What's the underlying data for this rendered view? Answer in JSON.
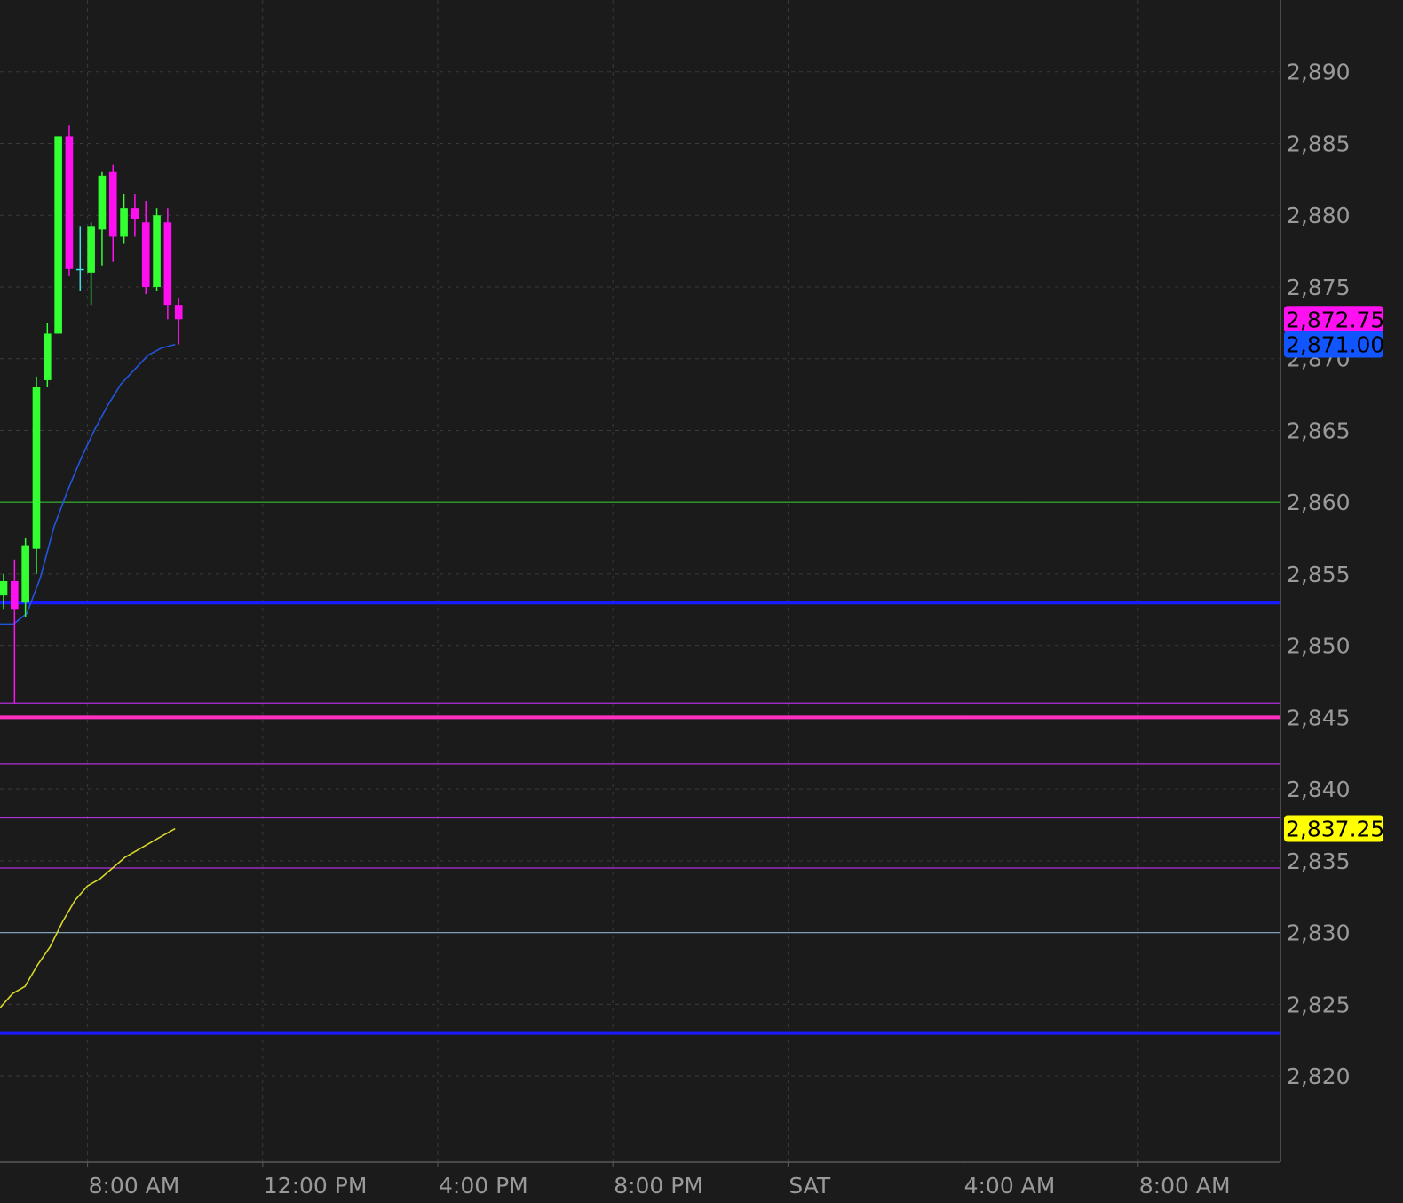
{
  "chart_data": {
    "type": "candlestick",
    "y_axis": {
      "side": "right",
      "ticks": [
        2890,
        2885,
        2880,
        2875,
        2870,
        2865,
        2860,
        2855,
        2850,
        2845,
        2840,
        2835,
        2830,
        2825,
        2820
      ],
      "tick_labels": [
        "2,890",
        "2,885",
        "2,880",
        "2,875",
        "2,870",
        "2,865",
        "2,860",
        "2,855",
        "2,850",
        "2,845",
        "2,840",
        "2,835",
        "2,830",
        "2,825",
        "2,820"
      ],
      "range": [
        2814.0,
        2895.0
      ]
    },
    "x_axis": {
      "range": [
        "Fri 06:00",
        "Sat 11:15"
      ],
      "ticks": [
        {
          "time": "Fri 08:00",
          "label": "8:00 AM"
        },
        {
          "time": "Fri 12:00",
          "label": "12:00 PM"
        },
        {
          "time": "Fri 16:00",
          "label": "4:00 PM"
        },
        {
          "time": "Fri 20:00",
          "label": "8:00 PM"
        },
        {
          "time": "Sat 00:00",
          "label": "SAT"
        },
        {
          "time": "Sat 04:00",
          "label": "4:00 AM"
        },
        {
          "time": "Sat 08:00",
          "label": "8:00 AM"
        }
      ]
    },
    "grid": true,
    "candles": [
      {
        "time": "Fri 06:00",
        "open": 2853.5,
        "high": 2855.0,
        "low": 2852.5,
        "close": 2854.5
      },
      {
        "time": "Fri 06:15",
        "open": 2854.5,
        "high": 2856.0,
        "low": 2846.0,
        "close": 2852.5
      },
      {
        "time": "Fri 06:30",
        "open": 2853.0,
        "high": 2857.5,
        "low": 2852.0,
        "close": 2857.0
      },
      {
        "time": "Fri 06:45",
        "open": 2856.75,
        "high": 2868.75,
        "low": 2855.0,
        "close": 2868.0
      },
      {
        "time": "Fri 07:00",
        "open": 2868.5,
        "high": 2872.5,
        "low": 2868.0,
        "close": 2871.75
      },
      {
        "time": "Fri 07:15",
        "open": 2871.75,
        "high": 2885.5,
        "low": 2871.75,
        "close": 2885.5
      },
      {
        "time": "Fri 07:30",
        "open": 2885.5,
        "high": 2886.25,
        "low": 2875.75,
        "close": 2876.25
      },
      {
        "time": "Fri 07:45",
        "open": 2876.25,
        "high": 2879.25,
        "low": 2874.75,
        "close": 2876.25
      },
      {
        "time": "Fri 08:00",
        "open": 2876.0,
        "high": 2879.5,
        "low": 2873.75,
        "close": 2879.25
      },
      {
        "time": "Fri 08:15",
        "open": 2879.0,
        "high": 2883.0,
        "low": 2876.5,
        "close": 2882.75
      },
      {
        "time": "Fri 08:30",
        "open": 2883.0,
        "high": 2883.5,
        "low": 2876.75,
        "close": 2878.5
      },
      {
        "time": "Fri 08:45",
        "open": 2878.5,
        "high": 2881.5,
        "low": 2878.0,
        "close": 2880.5
      },
      {
        "time": "Fri 09:00",
        "open": 2880.5,
        "high": 2881.5,
        "low": 2878.5,
        "close": 2879.75
      },
      {
        "time": "Fri 09:15",
        "open": 2879.5,
        "high": 2881.0,
        "low": 2874.5,
        "close": 2875.0
      },
      {
        "time": "Fri 09:30",
        "open": 2875.0,
        "high": 2880.5,
        "low": 2874.75,
        "close": 2880.0
      },
      {
        "time": "Fri 09:45",
        "open": 2879.5,
        "high": 2880.5,
        "low": 2872.75,
        "close": 2873.75
      },
      {
        "time": "Fri 10:00",
        "open": 2873.75,
        "high": 2874.25,
        "low": 2871.0,
        "close": 2872.75
      }
    ],
    "overlays": [
      {
        "type": "line",
        "color": "#2255dd",
        "values": [
          2851.5,
          2851.5,
          2852.25,
          2854.75,
          2858.25,
          2860.75,
          2863.0,
          2865.0,
          2866.75,
          2868.25,
          2869.25,
          2870.25,
          2870.75,
          2871.0
        ]
      },
      {
        "type": "line",
        "color": "#d6d628",
        "values": [
          2824.75,
          2825.75,
          2826.25,
          2827.75,
          2829.0,
          2830.75,
          2832.25,
          2833.25,
          2833.75,
          2834.5,
          2835.25,
          2835.75,
          2836.25,
          2836.75,
          2837.25
        ]
      }
    ],
    "levels": [
      {
        "value": 2860.0,
        "color": "#2ea12e"
      },
      {
        "value": 2853.0,
        "color": "#1a1aff"
      },
      {
        "value": 2846.0,
        "color": "#b030d8"
      },
      {
        "value": 2845.0,
        "color": "#ff30c0"
      },
      {
        "value": 2841.75,
        "color": "#b030d8"
      },
      {
        "value": 2838.0,
        "color": "#b030d8"
      },
      {
        "value": 2834.5,
        "color": "#b030d8"
      },
      {
        "value": 2830.0,
        "color": "#7fa0b8"
      },
      {
        "value": 2823.0,
        "color": "#1a1aff"
      }
    ],
    "price_labels": [
      {
        "value": 2872.75,
        "label": "2,872.75",
        "bg": "#ff10f0"
      },
      {
        "value": 2871.0,
        "label": "2,871.00",
        "bg": "#1155ff"
      },
      {
        "value": 2837.25,
        "label": "2,837.25",
        "bg": "#ffff00"
      }
    ],
    "colors": {
      "background": "#1b1b1c",
      "up": "#33ff33",
      "down": "#ff10f0",
      "doji": "#44dddd",
      "grid": "#3a3a3a",
      "axis": "#5a5a5a",
      "tick_text": "#9a9a9a"
    }
  }
}
